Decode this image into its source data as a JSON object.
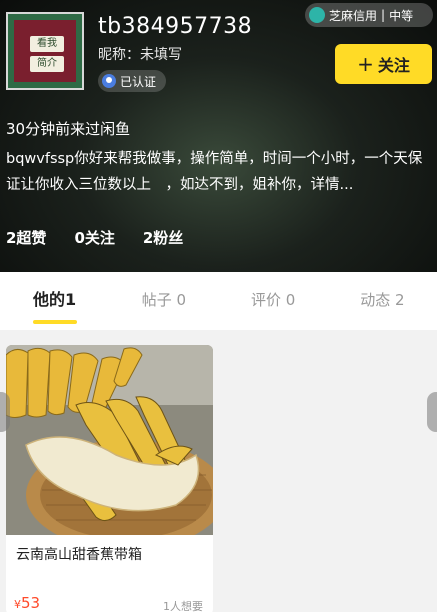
{
  "profile": {
    "username": "tb384957738",
    "nickname": "昵称：未填写",
    "verified_label": "已认证",
    "avatar_tags": [
      "看我",
      "简介"
    ],
    "last_seen": "30分钟前来过闲鱼",
    "bio": "bqwvfssp你好来帮我做事，操作简单，时间一个小时，一个天保证让你收入三位数以上　，如达不到，姐补你，详情..."
  },
  "credit": {
    "label": "芝麻信用",
    "level": "中等"
  },
  "follow_button": {
    "label": "关注"
  },
  "stats": [
    {
      "label": "2超赞"
    },
    {
      "label": "0关注"
    },
    {
      "label": "2粉丝"
    }
  ],
  "tabs": [
    {
      "label": "他的1",
      "active": true
    },
    {
      "label": "帖子 0",
      "active": false
    },
    {
      "label": "评价 0",
      "active": false
    },
    {
      "label": "动态 2",
      "active": false
    }
  ],
  "items": [
    {
      "title": "云南高山甜香蕉带箱",
      "currency": "¥",
      "price": "53",
      "wants": "1人想要",
      "image": "banana-photo"
    }
  ],
  "colors": {
    "accent": "#ffdb26",
    "price": "#ff4a2a"
  }
}
